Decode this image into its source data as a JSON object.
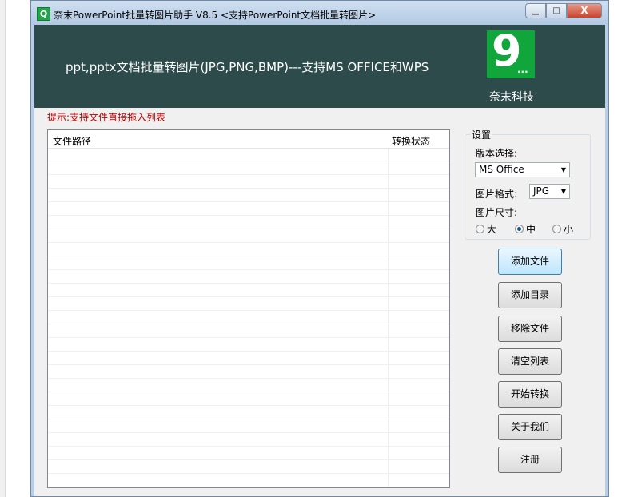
{
  "window": {
    "title": "奈末PowerPoint批量转图片助手 V8.5   <支持PowerPoint文档批量转图片>",
    "icon_letter": "Q",
    "minimize": "▁",
    "maximize": "□",
    "close": "X"
  },
  "banner": {
    "text": "ppt,pptx文档批量转图片(JPG,PNG,BMP)---支持MS OFFICE和WPS",
    "logo_text": "9",
    "logo_dots": "...",
    "company": "奈末科技"
  },
  "hint": "提示:支持文件直接拖入列表",
  "file_list": {
    "columns": [
      "文件路径",
      "转换状态"
    ],
    "rows": []
  },
  "settings": {
    "title": "设置",
    "version_label": "版本选择:",
    "version_value": "MS Office",
    "format_label": "图片格式:",
    "format_value": "JPG",
    "size_label": "图片尺寸:",
    "size_options": [
      "大",
      "中",
      "小"
    ],
    "size_selected": "中"
  },
  "buttons": {
    "add_file": "添加文件",
    "add_dir": "添加目录",
    "remove_file": "移除文件",
    "clear_list": "清空列表",
    "start": "开始转换",
    "about": "关于我们",
    "register": "注册"
  },
  "colors": {
    "banner_bg": "#2d4b4b",
    "logo_green": "#11a63c",
    "hint_red": "#c00000"
  }
}
